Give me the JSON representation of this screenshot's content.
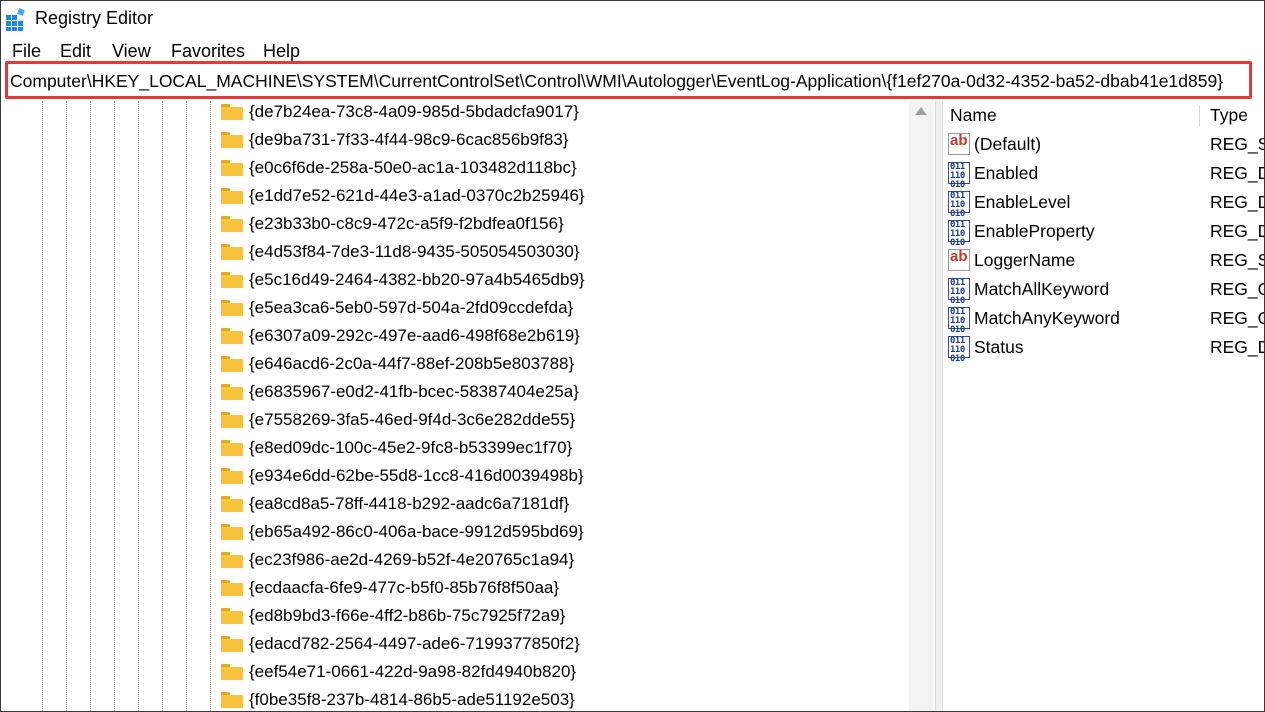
{
  "window": {
    "title": "Registry Editor"
  },
  "menu": [
    "File",
    "Edit",
    "View",
    "Favorites",
    "Help"
  ],
  "address": {
    "value": "Computer\\HKEY_LOCAL_MACHINE\\SYSTEM\\CurrentControlSet\\Control\\WMI\\Autologger\\EventLog-Application\\{f1ef270a-0d32-4352-ba52-dbab41e1d859}"
  },
  "tree": {
    "items": [
      "{de7b24ea-73c8-4a09-985d-5bdadcfa9017}",
      "{de9ba731-7f33-4f44-98c9-6cac856b9f83}",
      "{e0c6f6de-258a-50e0-ac1a-103482d118bc}",
      "{e1dd7e52-621d-44e3-a1ad-0370c2b25946}",
      "{e23b33b0-c8c9-472c-a5f9-f2bdfea0f156}",
      "{e4d53f84-7de3-11d8-9435-505054503030}",
      "{e5c16d49-2464-4382-bb20-97a4b5465db9}",
      "{e5ea3ca6-5eb0-597d-504a-2fd09ccdefda}",
      "{e6307a09-292c-497e-aad6-498f68e2b619}",
      "{e646acd6-2c0a-44f7-88ef-208b5e803788}",
      "{e6835967-e0d2-41fb-bcec-58387404e25a}",
      "{e7558269-3fa5-46ed-9f4d-3c6e282dde55}",
      "{e8ed09dc-100c-45e2-9fc8-b53399ec1f70}",
      "{e934e6dd-62be-55d8-1cc8-416d0039498b}",
      "{ea8cd8a5-78ff-4418-b292-aadc6a7181df}",
      "{eb65a492-86c0-406a-bace-9912d595bd69}",
      "{ec23f986-ae2d-4269-b52f-4e20765c1a94}",
      "{ecdaacfa-6fe9-477c-b5f0-85b76f8f50aa}",
      "{ed8b9bd3-f66e-4ff2-b86b-75c7925f72a9}",
      "{edacd782-2564-4497-ade6-7199377850f2}",
      "{eef54e71-0661-422d-9a98-82fd4940b820}",
      "{f0be35f8-237b-4814-86b5-ade51192e503}"
    ]
  },
  "values": {
    "headers": {
      "name": "Name",
      "type": "Type"
    },
    "rows": [
      {
        "name": "(Default)",
        "type": "REG_SZ",
        "icon": "string-value-icon"
      },
      {
        "name": "Enabled",
        "type": "REG_DV",
        "icon": "binary-value-icon"
      },
      {
        "name": "EnableLevel",
        "type": "REG_DV",
        "icon": "binary-value-icon"
      },
      {
        "name": "EnableProperty",
        "type": "REG_DV",
        "icon": "binary-value-icon"
      },
      {
        "name": "LoggerName",
        "type": "REG_SZ",
        "icon": "string-value-icon"
      },
      {
        "name": "MatchAllKeyword",
        "type": "REG_Q",
        "icon": "binary-value-icon"
      },
      {
        "name": "MatchAnyKeyword",
        "type": "REG_Q",
        "icon": "binary-value-icon"
      },
      {
        "name": "Status",
        "type": "REG_DV",
        "icon": "binary-value-icon"
      }
    ]
  },
  "colors": {
    "highlight_border": "#e53935",
    "folder": "#f7c23c"
  }
}
